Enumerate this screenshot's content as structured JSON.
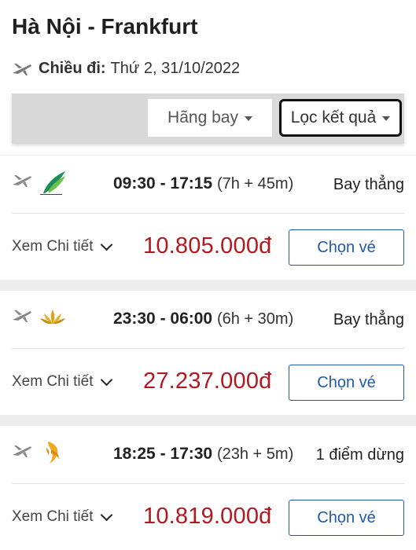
{
  "header": {
    "route_title": "Hà Nội - Frankfurt",
    "departure_label": "Chiều đi:",
    "departure_date": "Thứ 2, 31/10/2022"
  },
  "filters": {
    "airline_label": "Hãng bay",
    "filter_label": "Lọc kết quả"
  },
  "flights": [
    {
      "airline_logo": "bamboo-airways-logo",
      "depart_time": "09:30",
      "separator": "-",
      "arrive_time": "17:15",
      "duration": "(7h + 45m)",
      "stops": "Bay thẳng",
      "details_label": "Xem Chi tiết",
      "price": "10.805.000đ",
      "choose_label": "Chọn vé"
    },
    {
      "airline_logo": "vietnam-airlines-logo",
      "depart_time": "23:30",
      "separator": "-",
      "arrive_time": "06:00",
      "duration": "(6h + 30m)",
      "stops": "Bay thẳng",
      "details_label": "Xem Chi tiết",
      "price": "27.237.000đ",
      "choose_label": "Chọn vé"
    },
    {
      "airline_logo": "singapore-airlines-logo",
      "depart_time": "18:25",
      "separator": "-",
      "arrive_time": "17:30",
      "duration": "(23h + 5m)",
      "stops": "1 điểm dừng",
      "details_label": "Xem Chi tiết",
      "price": "10.819.000đ",
      "choose_label": "Chọn vé"
    }
  ],
  "colors": {
    "price": "#b0191f",
    "accent": "#1e5aa8",
    "background": "#ededed"
  }
}
